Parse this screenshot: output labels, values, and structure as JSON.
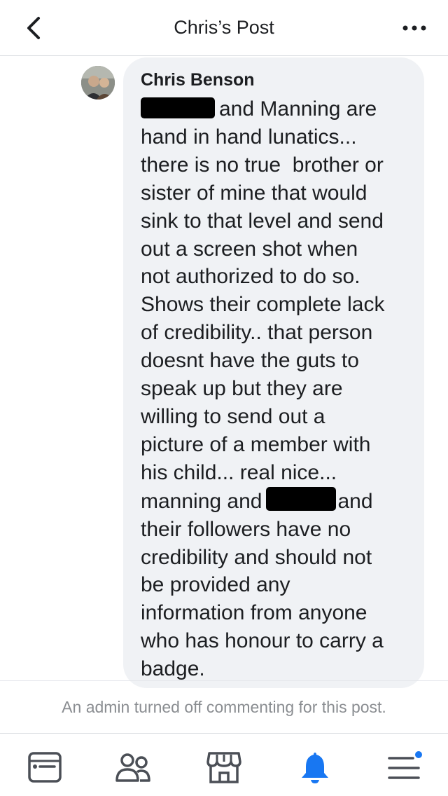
{
  "header": {
    "title": "Chris’s Post",
    "back_icon": "chevron-left-icon",
    "more_icon": "more-dots-icon"
  },
  "comment": {
    "author": "Chris Benson",
    "lines": [
      "and Manning are",
      "hand in hand lunatics...",
      "there is no true  brother or",
      "sister of mine that would",
      "sink to that level and send",
      "out a screen shot when",
      "not authorized to do so.",
      "Shows their complete lack",
      "of credibility.. that person",
      "doesnt have the guts to",
      "speak up but they are",
      "willing to send out a",
      "picture of a member with",
      "his child... real nice...",
      "manning and",
      "and",
      "their followers have no",
      "credibility and should not",
      "be provided any",
      "information from anyone",
      "who has honour to carry a",
      "badge."
    ]
  },
  "notice": "An admin turned off commenting for this post.",
  "tabbar": {
    "tabs": [
      {
        "icon": "news-feed-icon"
      },
      {
        "icon": "friends-icon"
      },
      {
        "icon": "marketplace-icon"
      },
      {
        "icon": "notifications-bell-icon",
        "active": true
      },
      {
        "icon": "menu-icon",
        "badge": true
      }
    ]
  },
  "colors": {
    "accent": "#1877f2",
    "bubble": "#f0f2f5",
    "icon": "#4b4f56",
    "muted": "#8a8d91"
  }
}
